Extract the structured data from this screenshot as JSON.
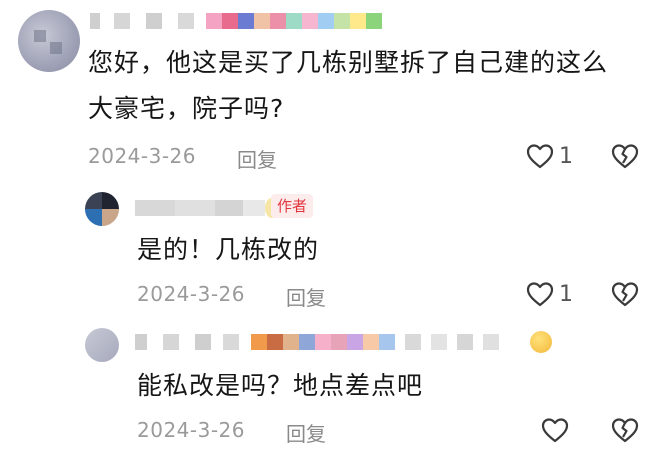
{
  "comments": [
    {
      "text_line1": "您好，他这是买了几栋别墅拆了自己建的这么",
      "text_line2": "大豪宅，院子吗?",
      "date": "2024-3-26",
      "reply_label": "回复",
      "likes": "1",
      "like_icon": "heart-outline-icon",
      "dislike_icon": "broken-heart-icon"
    },
    {
      "badge": "作者",
      "text": "是的！几栋改的",
      "date": "2024-3-26",
      "reply_label": "回复",
      "likes": "1",
      "like_icon": "heart-outline-icon",
      "dislike_icon": "broken-heart-icon"
    },
    {
      "text": "能私改是吗？地点差点吧",
      "date": "2024-3-26",
      "reply_label": "回复",
      "likes": "",
      "like_icon": "heart-outline-icon",
      "dislike_icon": "broken-heart-icon"
    }
  ],
  "colors": {
    "badge_bg": "#fdecec",
    "badge_text": "#e2363f",
    "meta_text": "#9a9a9a"
  }
}
